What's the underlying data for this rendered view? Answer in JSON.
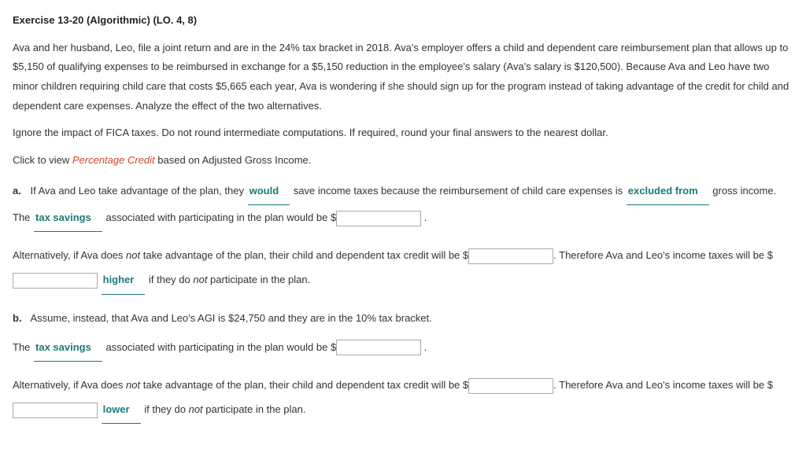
{
  "title": "Exercise 13-20 (Algorithmic) (LO. 4, 8)",
  "intro": "Ava and her husband, Leo, file a joint return and are in the 24% tax bracket in 2018. Ava's employer offers a child and dependent care reimbursement plan that allows up to $5,150 of qualifying expenses to be reimbursed in exchange for a $5,150 reduction in the employee's salary (Ava's salary is $120,500). Because Ava and Leo have two minor children requiring child care that costs $5,665 each year, Ava is wondering if she should sign up for the program instead of taking advantage of the credit for child and dependent care expenses. Analyze the effect of the two alternatives.",
  "note": "Ignore the impact of FICA taxes. Do not round intermediate computations. If required, round your final answers to the nearest dollar.",
  "click_pre": "Click to view ",
  "click_link": "Percentage Credit",
  "click_post": " based on Adjusted Gross Income.",
  "a": {
    "label": "a.",
    "s1_pre": "If Ava and Leo take advantage of the plan, they ",
    "s1_d1": "would",
    "s1_mid1": " save income taxes because the reimbursement of child care expenses is ",
    "s1_d2": "excluded from",
    "s1_mid2": " gross income. The ",
    "s1_d3": "tax savings",
    "s1_mid3": " associated with participating in the plan would be ",
    "s1_end": ".",
    "s2_pre": "Alternatively, if Ava does ",
    "s2_not": "not",
    "s2_mid1": " take advantage of the plan, their child and dependent tax credit will be ",
    "s2_mid2": ". Therefore Ava and Leo's income taxes will be ",
    "s2_d1": "higher",
    "s2_mid3": " if they do ",
    "s2_not2": "not",
    "s2_end": " participate in the plan."
  },
  "b": {
    "label": "b.",
    "intro": "Assume, instead, that Ava and Leo's AGI is $24,750 and they are in the 10% tax bracket.",
    "s1_pre": "The ",
    "s1_d1": "tax savings",
    "s1_mid1": " associated with participating in the plan would be ",
    "s1_end": ".",
    "s2_pre": "Alternatively, if Ava does ",
    "s2_not": "not",
    "s2_mid1": " take advantage of the plan, their child and dependent tax credit will be ",
    "s2_mid2": ". Therefore Ava and Leo's income taxes will be ",
    "s2_d1": "lower",
    "s2_mid3": " if they do ",
    "s2_not2": "not",
    "s2_end": " participate in the plan."
  }
}
